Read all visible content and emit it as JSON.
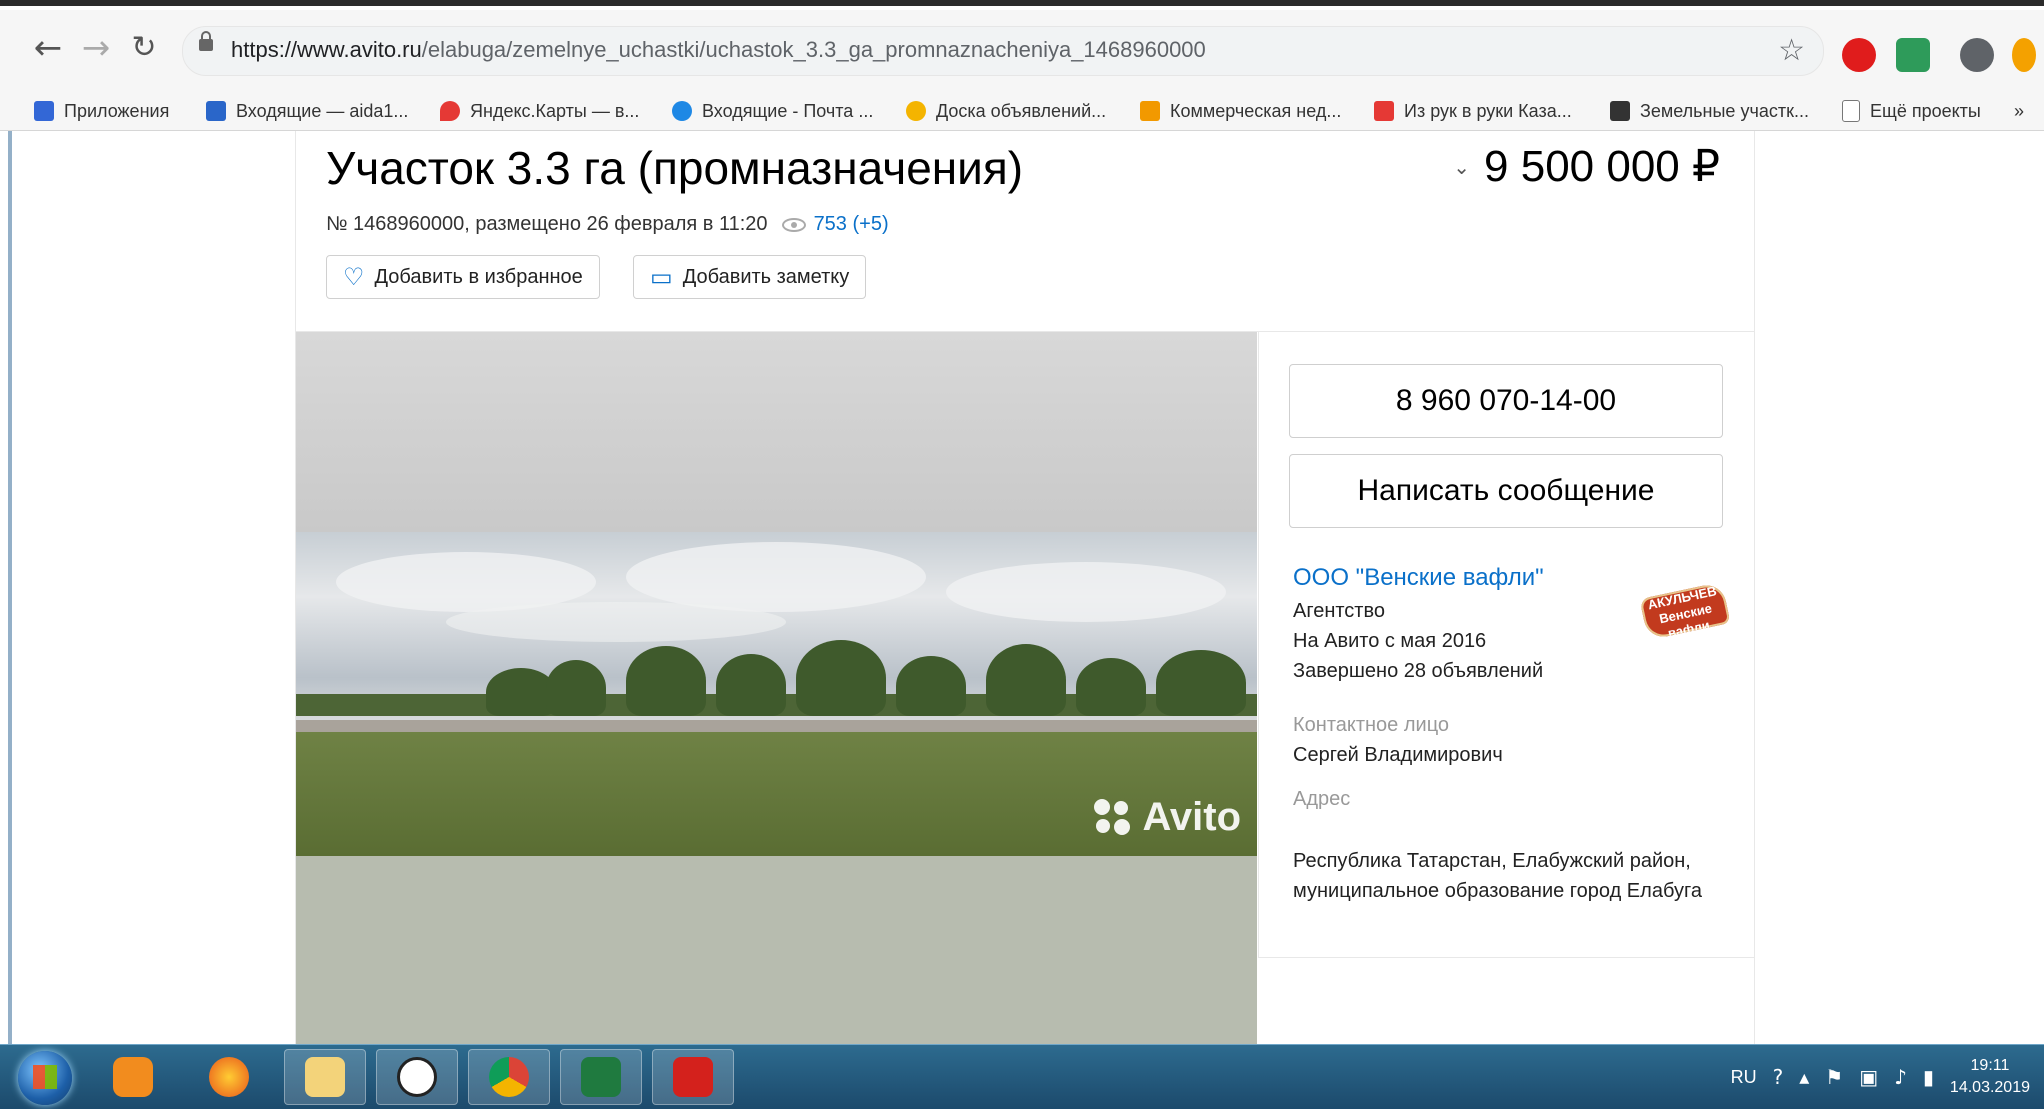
{
  "browser": {
    "url_host": "https://www.avito.ru",
    "url_path": "/elabuga/zemelnye_uchastki/uchastok_3.3_ga_promnaznacheniya_1468960000",
    "bookmarks": [
      {
        "label": "Приложения",
        "color": "#3367d6"
      },
      {
        "label": "Входящие — aida1...",
        "color": "#2a66c9"
      },
      {
        "label": "Яндекс.Карты — в...",
        "color": "#e53935"
      },
      {
        "label": "Входящие - Почта ...",
        "color": "#1e88e5"
      },
      {
        "label": "Доска объявлений...",
        "color": "#f4b400"
      },
      {
        "label": "Коммерческая нед...",
        "color": "#f29900"
      },
      {
        "label": "Из рук в руки Каза...",
        "color": "#e53935"
      },
      {
        "label": "Земельные участк...",
        "color": "#333333"
      },
      {
        "label": "Ещё проекты",
        "color": "#777777"
      }
    ],
    "more": "»"
  },
  "listing": {
    "title": "Участок 3.3 га (промназначения)",
    "price": "9 500 000 ₽",
    "meta": "№ 1468960000, размещено 26 февраля в 11:20",
    "views": "753 (+5)",
    "fav_button": "Добавить в избранное",
    "note_button": "Добавить заметку",
    "watermark": "Avito"
  },
  "sidebar": {
    "phone": "8 960 070-14-00",
    "message_button": "Написать сообщение",
    "seller_name": "ООО \"Венские вафли\"",
    "seller_type": "Агентство",
    "on_avito": "На Авито с мая 2016",
    "completed": "Завершено 28 объявлений",
    "contact_label": "Контактное лицо",
    "contact_name": "Сергей Владимирович",
    "address_label": "Адрес",
    "address": "Республика Татарстан, Елабужский район, муниципальное образование город Елабуга",
    "logo_text": "АКУЛЬЧЕВ Венские вафли"
  },
  "taskbar": {
    "lang": "RU",
    "time": "19:11",
    "date": "14.03.2019"
  }
}
